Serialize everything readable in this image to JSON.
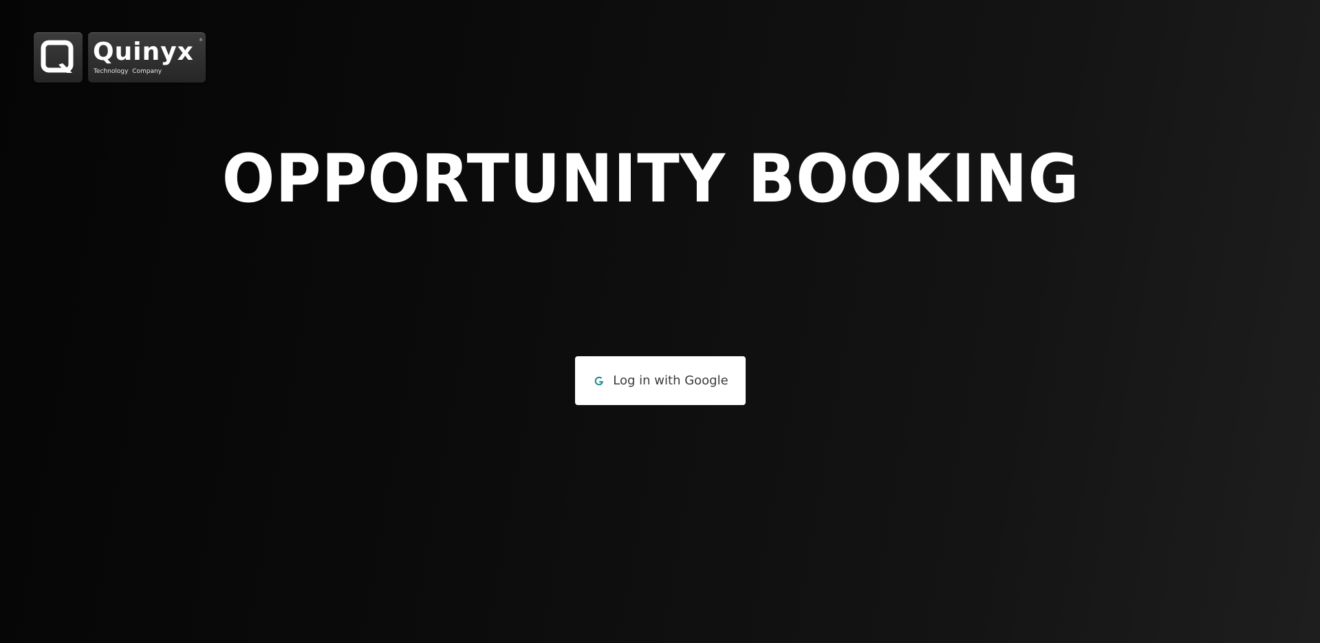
{
  "logo": {
    "name": "Quinyx",
    "tagline": "Technology Company",
    "registered_mark": "®"
  },
  "header": {
    "title": "OPPORTUNITY BOOKING"
  },
  "login": {
    "button_label": "Log in with Google",
    "icon": "google-g-icon",
    "icon_color": "#1a8a8a"
  }
}
